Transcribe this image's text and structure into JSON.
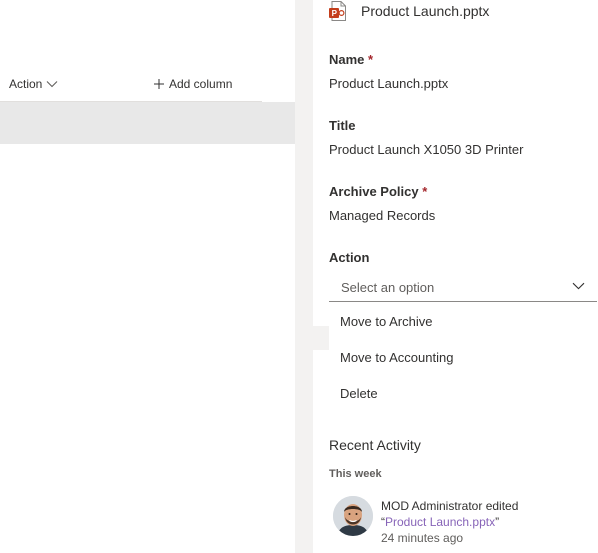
{
  "list": {
    "columns": {
      "action_label": "Action",
      "add_column_label": "Add column"
    }
  },
  "panel": {
    "file_name": "Product Launch.pptx",
    "fields": {
      "name": {
        "label": "Name",
        "required_mark": "*",
        "value": "Product Launch.pptx"
      },
      "title": {
        "label": "Title",
        "value": "Product Launch X1050 3D Printer"
      },
      "archive_policy": {
        "label": "Archive Policy",
        "required_mark": "*",
        "value": "Managed Records"
      },
      "action": {
        "label": "Action",
        "placeholder": "Select an option",
        "options": [
          "Move to Archive",
          "Move to Accounting",
          "Delete"
        ]
      }
    },
    "recent_activity": {
      "title": "Recent Activity",
      "group_label": "This week",
      "entries": [
        {
          "user": "MOD Administrator",
          "verb": "edited",
          "quote_open": "“",
          "file": "Product Launch.pptx",
          "quote_close": "”",
          "time": "24 minutes ago"
        }
      ]
    }
  },
  "icons": {
    "file_icon": "powerpoint-file-icon",
    "action_sort": "chevron-down-icon",
    "add_column": "plus-icon",
    "dropdown": "chevron-down-icon",
    "avatar": "user-avatar"
  },
  "colors": {
    "required": "#a4262c",
    "link": "#8764b8",
    "selected_row": "#e8e8e8",
    "scrim": "#f3f2f1",
    "powerpoint": "#c43e1c"
  }
}
